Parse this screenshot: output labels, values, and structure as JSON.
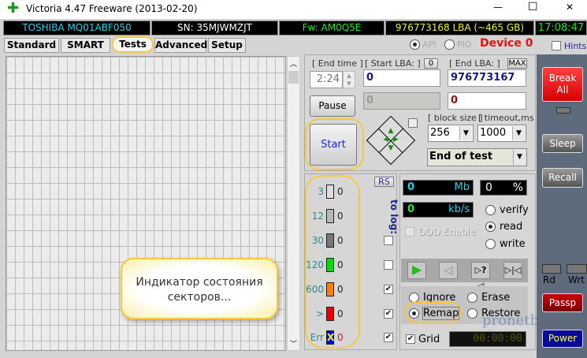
{
  "title": "Victoria 4.47  Freeware (2013-02-20)",
  "window_controls": {
    "minimize": "—",
    "maximize": "☐",
    "close": "✕"
  },
  "info": {
    "model": "TOSHIBA MQ01ABF050",
    "serial": "SN: 35MJWMZJT",
    "firmware": "Fw: AM0Q5E",
    "capacity": "976773168 LBA (~465 GB)",
    "clock": "17:08:47"
  },
  "tabs": [
    {
      "label": "Standard"
    },
    {
      "label": "SMART"
    },
    {
      "label": "Tests"
    },
    {
      "label": "Advanced"
    },
    {
      "label": "Setup"
    }
  ],
  "mode": {
    "api": "API",
    "pio": "PIO",
    "device": "Device 0",
    "hints": "Hints"
  },
  "controls": {
    "end_time_label": "[ End time ]",
    "end_time": "2:24",
    "start_lba_label": "[ Start LBA: ]",
    "zero_btn": "0",
    "start_lba": "0",
    "end_lba_label": "[ End LBA: ]",
    "max_btn": "MAX",
    "end_lba": "976773167",
    "current_lba": "0",
    "current_end": "0",
    "pause": "Pause",
    "start": "Start",
    "block_size_label": "[ block size ]",
    "block_size": "256",
    "timeout_label": "[ timeout,ms ]",
    "timeout": "1000",
    "end_action": "End of test"
  },
  "indicators": [
    {
      "label": "3",
      "count": "0",
      "color": "#dddddd",
      "log": false
    },
    {
      "label": "12",
      "count": "0",
      "color": "#b8b8b8",
      "log": false
    },
    {
      "label": "30",
      "count": "0",
      "color": "#777777",
      "log": false
    },
    {
      "label": "120",
      "count": "0",
      "color": "#00e000",
      "log": false
    },
    {
      "label": "600",
      "count": "0",
      "color": "#ff8000",
      "log": true
    },
    {
      "label": ">",
      "count": "0",
      "color": "#ee0000",
      "log": true
    },
    {
      "label": "Err",
      "count": "0",
      "color": "#0000ff",
      "log": true
    }
  ],
  "err_mark": "X",
  "rs": "RS",
  "to_log": "to log:",
  "stats": {
    "mb": "0",
    "mb_unit": "Mb",
    "pct": "0",
    "pct_unit": "%",
    "speed": "0",
    "speed_unit": "kb/s"
  },
  "modes": {
    "verify": "verify",
    "read": "read",
    "write": "write",
    "ddd": "DDD Enable"
  },
  "actions": {
    "ignore": "Ignore",
    "erase": "Erase",
    "remap": "Remap",
    "restore": "Restore",
    "grid": "Grid",
    "timer": "00:00:00"
  },
  "sidebar": {
    "break": "Break All",
    "sleep": "Sleep",
    "recall": "Recall",
    "rd": "Rd",
    "wrt": "Wrt",
    "passp": "Passp",
    "power": "Power"
  },
  "callout": "Индикатор состояния секторов...",
  "watermark": "pronetblog.by"
}
